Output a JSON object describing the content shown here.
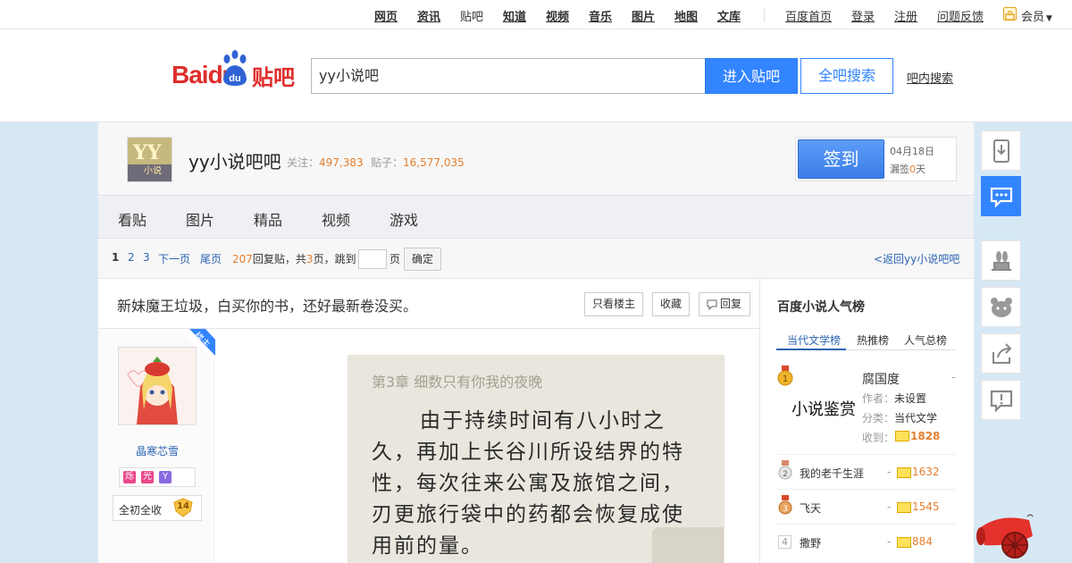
{
  "topnav": {
    "links": [
      "网页",
      "资讯",
      "贴吧",
      "知道",
      "视频",
      "音乐",
      "图片",
      "地图",
      "文库"
    ],
    "current": "贴吧",
    "right": [
      "百度首页",
      "登录",
      "注册",
      "问题反馈"
    ],
    "member": "会员"
  },
  "header": {
    "logo_brand": "Baidu",
    "logo_suffix": "贴吧",
    "search_value": "yy小说吧",
    "enter_button": "进入贴吧",
    "all_search_button": "全吧搜索",
    "in_bar_search": "吧内搜索"
  },
  "forum": {
    "name": "yy小说吧吧",
    "follow_label": "关注：",
    "follow_count": "497,383",
    "posts_label": "贴子：",
    "posts_count": "16,577,035",
    "signin_button": "签到",
    "sign_date": "04月18日",
    "sign_miss_prefix": "漏签",
    "sign_miss_count": "0",
    "sign_miss_suffix": "天"
  },
  "tabs": [
    "看贴",
    "图片",
    "精品",
    "视频",
    "游戏"
  ],
  "pager": {
    "current": "1",
    "pages": [
      "2",
      "3"
    ],
    "next": "下一页",
    "last": "尾页",
    "reply_count": "207",
    "reply_text": "回复贴，共",
    "page_count": "3",
    "page_text": "页，跳到",
    "page_unit": "页",
    "confirm": "确定",
    "back_link": "<返回yy小说吧吧"
  },
  "thread": {
    "title": "新妹魔王垃圾，白买你的书，还好最新卷没买。",
    "only_host": "只看楼主",
    "favorite": "收藏",
    "reply": "回复"
  },
  "author": {
    "corner_badge": "楼主",
    "name": "晶寒芯雪",
    "badges": [
      "烁",
      "光",
      "Y"
    ],
    "level_title": "全初全收",
    "level": "14"
  },
  "post_image": {
    "chapter": "第3章 细数只有你我的夜晚",
    "lines": [
      "由于持续时间有八小时之",
      "久，再加上长谷川所设结界的特",
      "性，每次往来公寓及旅馆之间，",
      "刃更旅行袋中的药都会恢复成使",
      "用前的量。"
    ]
  },
  "ranking": {
    "title": "百度小说人气榜",
    "tabs": [
      "当代文学榜",
      "热推榜",
      "人气总榜"
    ],
    "active_tab": "当代文学榜",
    "top": {
      "book": "腐国度",
      "author_label": "作者：",
      "author": "未设置",
      "category_label": "分类：",
      "category": "当代文学",
      "received_label": "收到：",
      "received": "1828",
      "cover_text": "小说鉴赏"
    },
    "items": [
      {
        "rank": "2",
        "name": "我的老千生涯",
        "count": "1632"
      },
      {
        "rank": "3",
        "name": "飞天",
        "count": "1545"
      },
      {
        "rank": "4",
        "name": "撒野",
        "count": "884"
      }
    ],
    "dash": "-"
  },
  "colors": {
    "brand_blue": "#3385ff",
    "link_blue": "#2d64b3",
    "orange": "#e57f2f",
    "logo_red": "#de2d2c"
  },
  "sidebar_tools": [
    "download-icon",
    "message-icon",
    "hat-icon",
    "bear-icon",
    "share-icon",
    "report-icon"
  ]
}
